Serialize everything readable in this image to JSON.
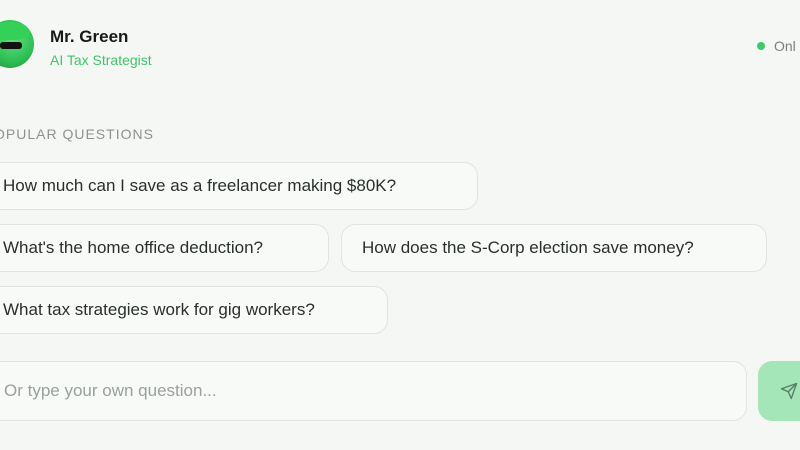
{
  "header": {
    "name": "Mr. Green",
    "role": "AI Tax Strategist",
    "status": "Onl"
  },
  "section": {
    "label": "OPULAR QUESTIONS"
  },
  "questions": [
    "How much can I save as a freelancer making $80K?",
    "What's the home office deduction?",
    "How does the S-Corp election save money?",
    "What tax strategies work for gig workers?"
  ],
  "composer": {
    "placeholder": "Or type your own question..."
  },
  "colors": {
    "accent": "#3fc46a",
    "send_button": "#a5e6b8",
    "status_dot": "#3ccb6a"
  },
  "icons": {
    "avatar": "mr-green-avatar",
    "send": "send-icon"
  }
}
